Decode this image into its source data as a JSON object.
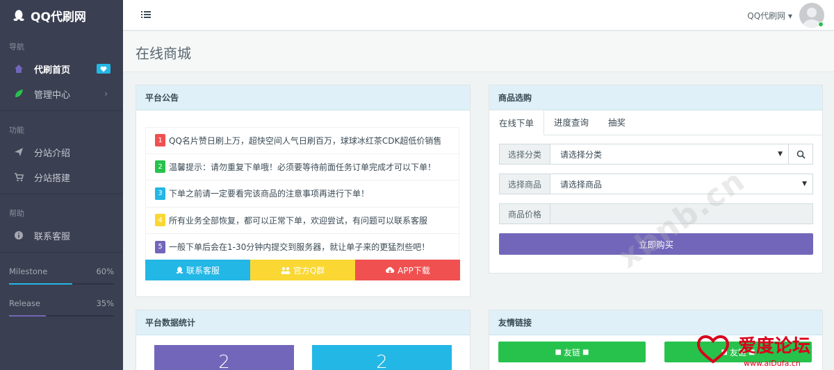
{
  "brand": {
    "title": "QQ代刷网"
  },
  "sidebar": {
    "sections": [
      {
        "label": "导航"
      },
      {
        "label": "功能"
      },
      {
        "label": "帮助"
      }
    ],
    "items": [
      {
        "label": "代刷首页",
        "icon": "home-icon"
      },
      {
        "label": "管理中心",
        "icon": "leaf-icon"
      },
      {
        "label": "分站介绍",
        "icon": "send-icon"
      },
      {
        "label": "分站搭建",
        "icon": "cart-icon"
      },
      {
        "label": "联系客服",
        "icon": "info-icon"
      }
    ],
    "progress": [
      {
        "label": "Milestone",
        "value_text": "60%",
        "value": 0.6,
        "color": "#23b7e5"
      },
      {
        "label": "Release",
        "value_text": "35%",
        "value": 0.35,
        "color": "#7266ba"
      }
    ]
  },
  "topbar": {
    "user_name": "QQ代刷网 ▾"
  },
  "page": {
    "title": "在线商城"
  },
  "notice_panel": {
    "title": "平台公告",
    "notices": [
      {
        "num": "1",
        "text": "QQ名片赞日刷上万，超快空间人气日刷百万，球球冰红茶CDK超低价销售",
        "color": "#f05050"
      },
      {
        "num": "2",
        "text": "温馨提示：请勿重复下单哦！必须要等待前面任务订单完成才可以下单！",
        "color": "#27c24c"
      },
      {
        "num": "3",
        "text": "下单之前请一定要看完该商品的注意事项再进行下单！",
        "color": "#23b7e5"
      },
      {
        "num": "4",
        "text": "所有业务全部恢复，都可以正常下单，欢迎尝试，有问题可以联系客服",
        "color": "#fad733"
      },
      {
        "num": "5",
        "text": "一般下单后会在1-30分钟内提交到服务器，就让单子来的更猛烈些吧！",
        "color": "#7266ba"
      }
    ],
    "buttons": [
      {
        "label": "联系客服",
        "color": "#23b7e5"
      },
      {
        "label": "官方Q群",
        "color": "#fad733"
      },
      {
        "label": "APP下载",
        "color": "#f05050"
      }
    ]
  },
  "order_panel": {
    "title": "商品选购",
    "tabs": [
      "在线下单",
      "进度查询",
      "抽奖"
    ],
    "category": {
      "label": "选择分类",
      "value": "请选择分类"
    },
    "product": {
      "label": "选择商品",
      "value": "请选择商品"
    },
    "price": {
      "label": "商品价格",
      "value": ""
    },
    "buy_label": "立即购买"
  },
  "stats_panel": {
    "title": "平台数据统计",
    "stats": [
      {
        "value": "2",
        "color": "#7266ba"
      },
      {
        "value": "2",
        "color": "#23b7e5"
      }
    ]
  },
  "links_panel": {
    "title": "友情链接",
    "buttons": [
      {
        "label": "友链"
      },
      {
        "label": "友链"
      }
    ]
  },
  "watermark": {
    "diagonal": "xbnb.cn",
    "logo_text": "爱度论坛",
    "logo_url": "www.aiDufa.cn"
  }
}
